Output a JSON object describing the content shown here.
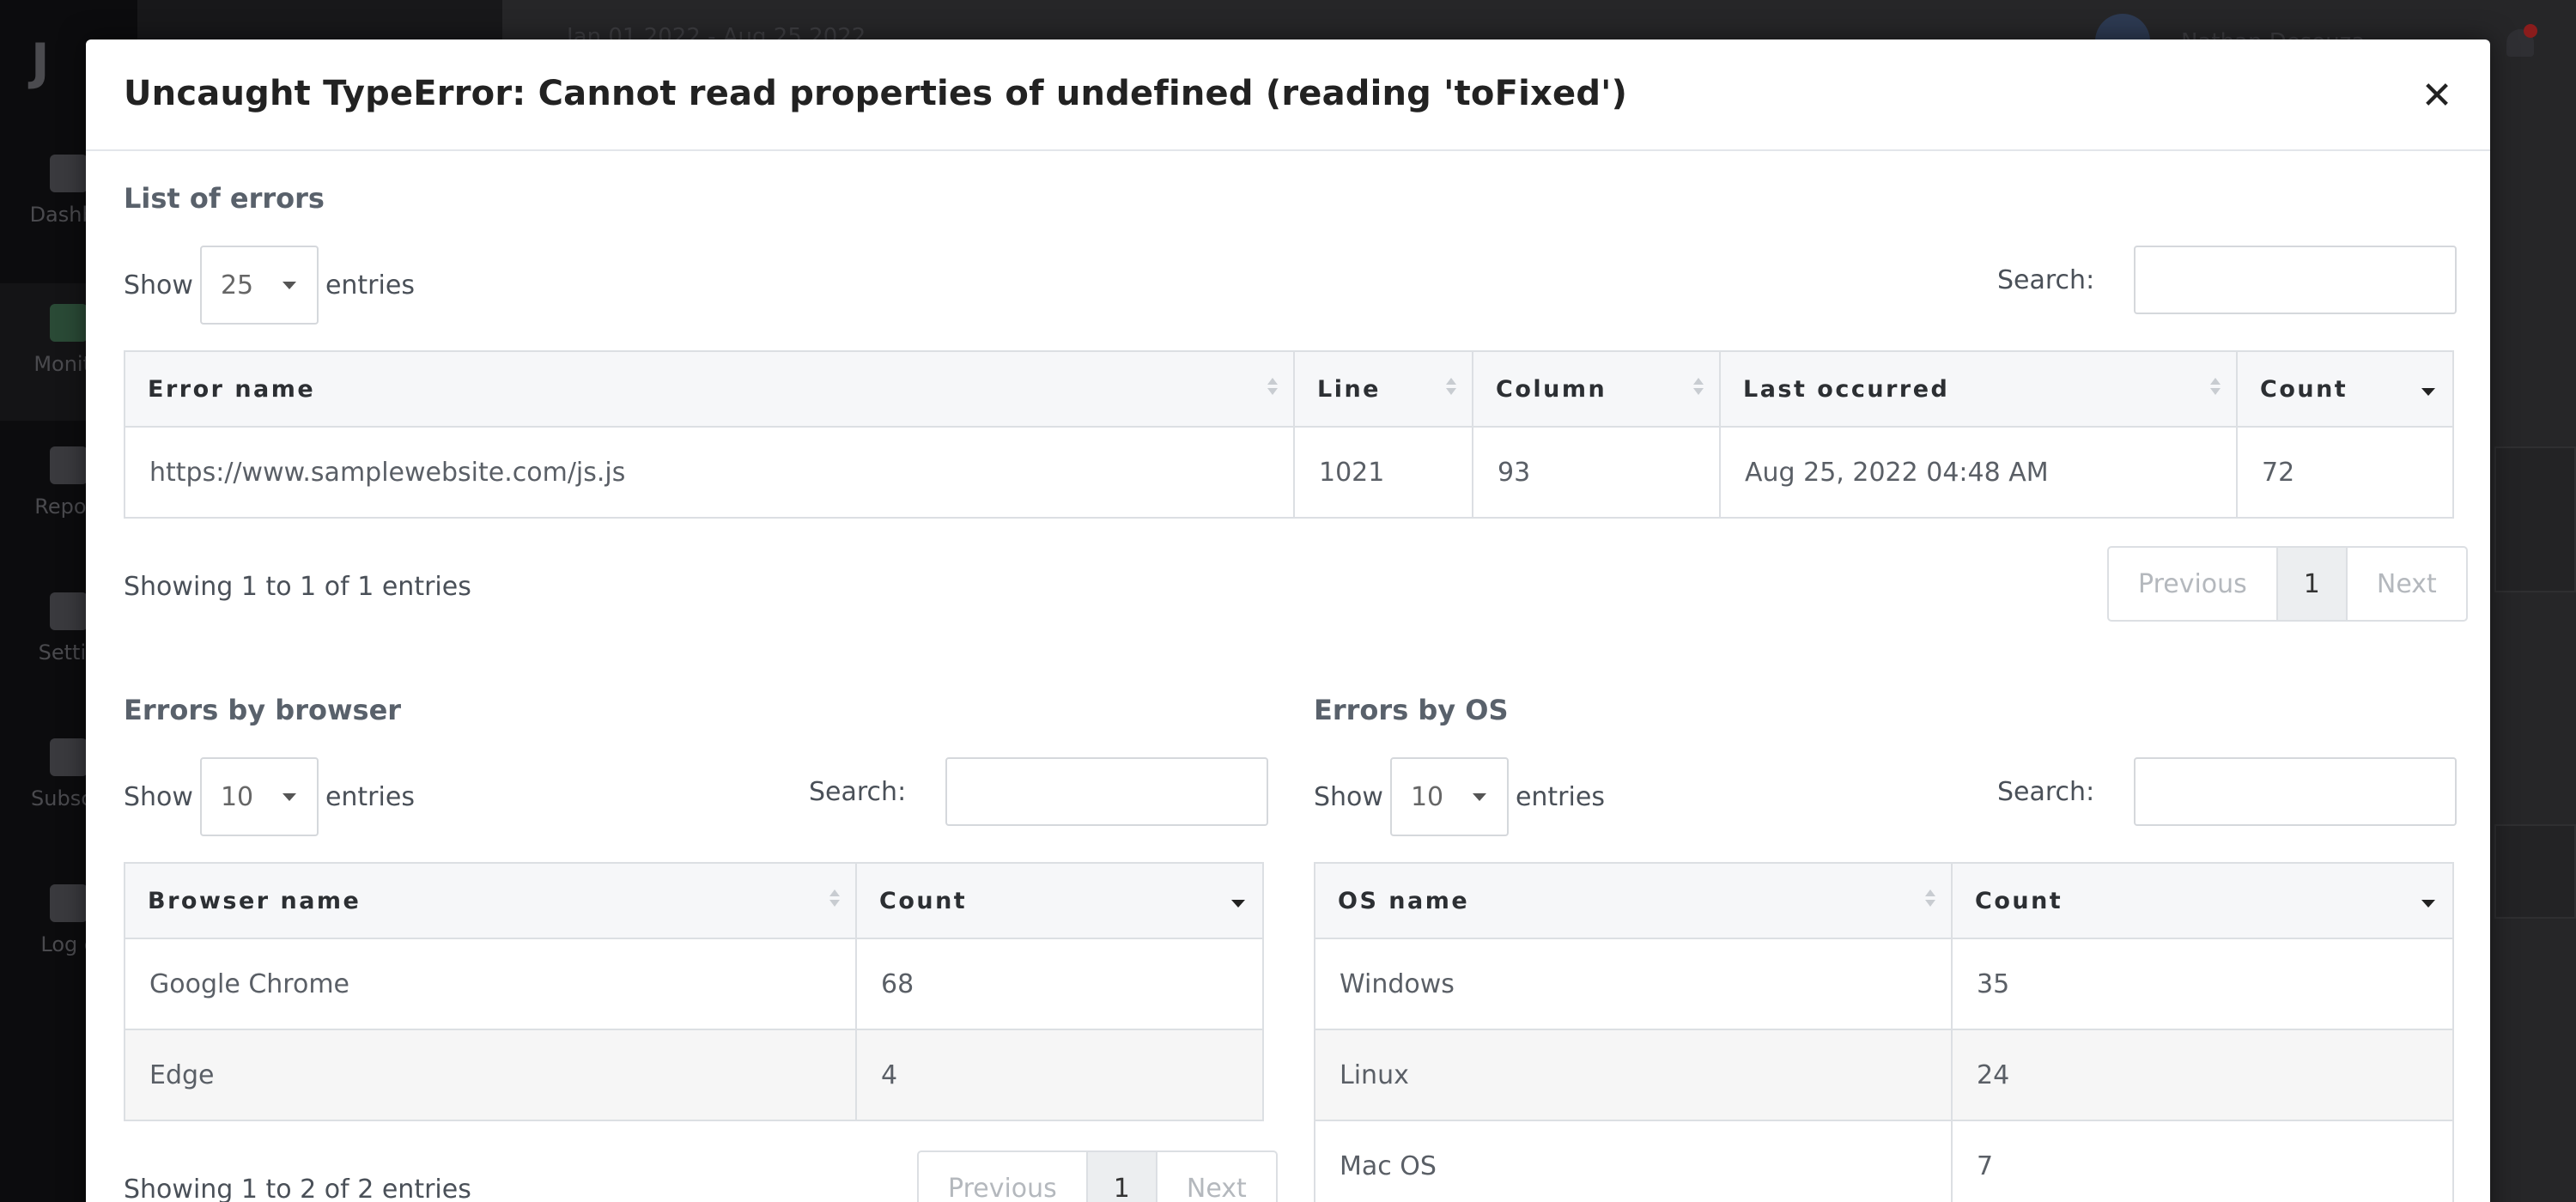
{
  "background": {
    "topbar_text": "Jan 01 2022 - Aug 25 2022",
    "user_name": "Nathan Desouza",
    "nav": [
      {
        "label": "Dashbo"
      },
      {
        "label": "Monito"
      },
      {
        "label": "Report"
      },
      {
        "label": "Settin"
      },
      {
        "label": "Subscri"
      },
      {
        "label": "Log o"
      }
    ]
  },
  "modal": {
    "title": "Uncaught TypeError: Cannot read properties of undefined (reading 'toFixed')",
    "close_icon": "close-icon"
  },
  "errors_list": {
    "title": "List of errors",
    "show_label": "Show",
    "entries_label": "entries",
    "length_value": "25",
    "search_label": "Search:",
    "search_value": "",
    "columns": [
      "Error name",
      "Line",
      "Column",
      "Last occurred",
      "Count"
    ],
    "rows": [
      {
        "name": "https://www.samplewebsite.com/js.js",
        "line": "1021",
        "column": "93",
        "last_occurred": "Aug 25, 2022 04:48 AM",
        "count": "72"
      }
    ],
    "info": "Showing 1 to 1 of 1 entries",
    "pager": {
      "previous": "Previous",
      "current": "1",
      "next": "Next"
    }
  },
  "errors_by_browser": {
    "title": "Errors by browser",
    "show_label": "Show",
    "entries_label": "entries",
    "length_value": "10",
    "search_label": "Search:",
    "search_value": "",
    "columns": [
      "Browser name",
      "Count"
    ],
    "rows": [
      {
        "name": "Google Chrome",
        "count": "68"
      },
      {
        "name": "Edge",
        "count": "4"
      }
    ],
    "info": "Showing 1 to 2 of 2 entries",
    "pager": {
      "previous": "Previous",
      "current": "1",
      "next": "Next"
    }
  },
  "errors_by_os": {
    "title": "Errors by OS",
    "show_label": "Show",
    "entries_label": "entries",
    "length_value": "10",
    "search_label": "Search:",
    "search_value": "",
    "columns": [
      "OS name",
      "Count"
    ],
    "rows": [
      {
        "name": "Windows",
        "count": "35"
      },
      {
        "name": "Linux",
        "count": "24"
      },
      {
        "name": "Mac OS",
        "count": "7"
      }
    ]
  }
}
